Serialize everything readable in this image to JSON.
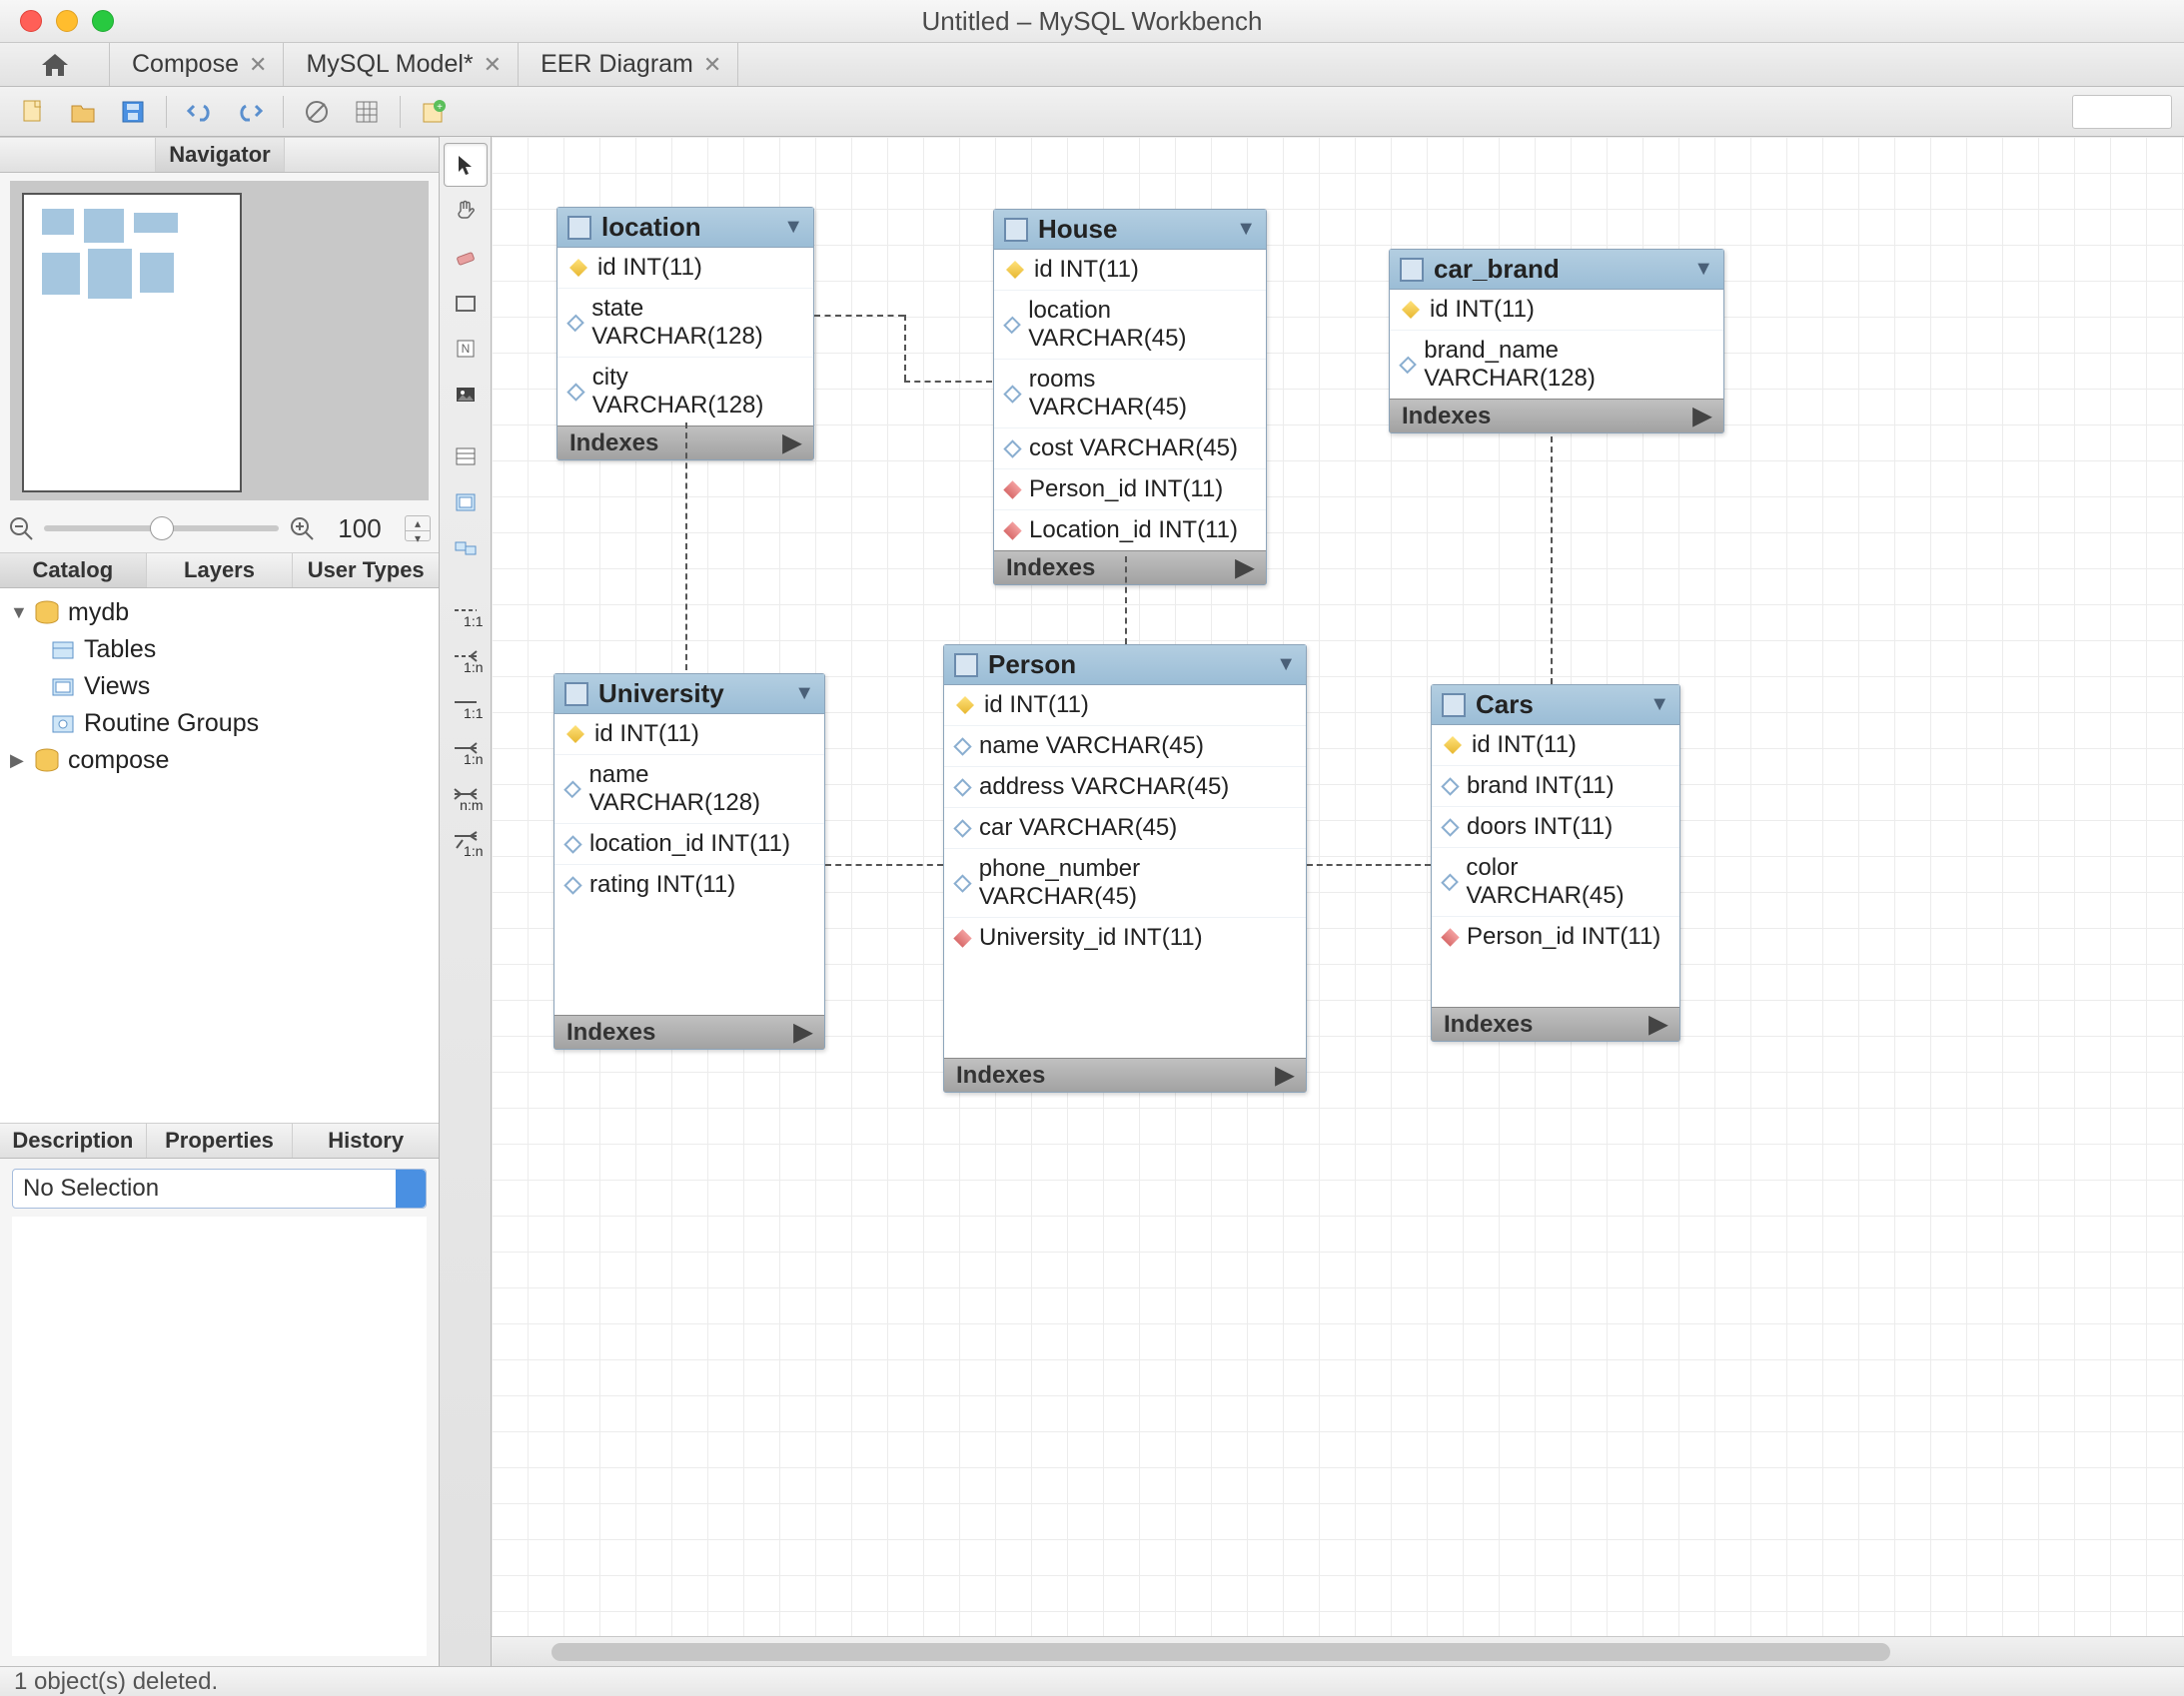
{
  "window": {
    "title": "Untitled – MySQL Workbench"
  },
  "tabs": [
    {
      "label": "Compose",
      "closable": true
    },
    {
      "label": "MySQL Model*",
      "closable": true
    },
    {
      "label": "EER Diagram",
      "closable": true
    }
  ],
  "sidebar": {
    "navigator_label": "Navigator",
    "zoom_value": "100",
    "catalog_tabs": [
      "Catalog",
      "Layers",
      "User Types"
    ],
    "tree": {
      "db1": {
        "name": "mydb",
        "children": [
          "Tables",
          "Views",
          "Routine Groups"
        ]
      },
      "db2": {
        "name": "compose"
      }
    },
    "desc_tabs": [
      "Description",
      "Properties",
      "History"
    ],
    "selection_text": "No Selection"
  },
  "palette_tools": [
    "pointer",
    "hand",
    "eraser",
    "region",
    "note",
    "image",
    "table",
    "layer",
    "view",
    "rel-1-1",
    "rel-1-n",
    "rel-1-1b",
    "rel-1-nb",
    "rel-n-m",
    "rel-1-n-c"
  ],
  "entities": {
    "location": {
      "name": "location",
      "cols": [
        {
          "icon": "key",
          "text": "id INT(11)"
        },
        {
          "icon": "dia",
          "text": "state VARCHAR(128)"
        },
        {
          "icon": "dia",
          "text": "city VARCHAR(128)"
        }
      ],
      "indexes_label": "Indexes"
    },
    "house": {
      "name": "House",
      "cols": [
        {
          "icon": "key",
          "text": "id INT(11)"
        },
        {
          "icon": "dia",
          "text": "location VARCHAR(45)"
        },
        {
          "icon": "dia",
          "text": "rooms VARCHAR(45)"
        },
        {
          "icon": "dia",
          "text": "cost VARCHAR(45)"
        },
        {
          "icon": "fk",
          "text": "Person_id INT(11)"
        },
        {
          "icon": "fk",
          "text": "Location_id INT(11)"
        }
      ],
      "indexes_label": "Indexes"
    },
    "car_brand": {
      "name": "car_brand",
      "cols": [
        {
          "icon": "key",
          "text": "id INT(11)"
        },
        {
          "icon": "dia",
          "text": "brand_name VARCHAR(128)"
        }
      ],
      "indexes_label": "Indexes"
    },
    "university": {
      "name": "University",
      "cols": [
        {
          "icon": "key",
          "text": "id INT(11)"
        },
        {
          "icon": "dia",
          "text": "name VARCHAR(128)"
        },
        {
          "icon": "dia",
          "text": "location_id INT(11)"
        },
        {
          "icon": "dia",
          "text": "rating INT(11)"
        }
      ],
      "indexes_label": "Indexes"
    },
    "person": {
      "name": "Person",
      "cols": [
        {
          "icon": "key",
          "text": "id INT(11)"
        },
        {
          "icon": "dia",
          "text": "name VARCHAR(45)"
        },
        {
          "icon": "dia",
          "text": "address VARCHAR(45)"
        },
        {
          "icon": "dia",
          "text": "car VARCHAR(45)"
        },
        {
          "icon": "dia",
          "text": "phone_number VARCHAR(45)"
        },
        {
          "icon": "fk",
          "text": "University_id INT(11)"
        }
      ],
      "indexes_label": "Indexes"
    },
    "cars": {
      "name": "Cars",
      "cols": [
        {
          "icon": "key",
          "text": "id INT(11)"
        },
        {
          "icon": "dia",
          "text": "brand INT(11)"
        },
        {
          "icon": "dia",
          "text": "doors INT(11)"
        },
        {
          "icon": "dia",
          "text": "color VARCHAR(45)"
        },
        {
          "icon": "fk",
          "text": "Person_id INT(11)"
        }
      ],
      "indexes_label": "Indexes"
    }
  },
  "statusbar": {
    "text": "1 object(s) deleted."
  }
}
